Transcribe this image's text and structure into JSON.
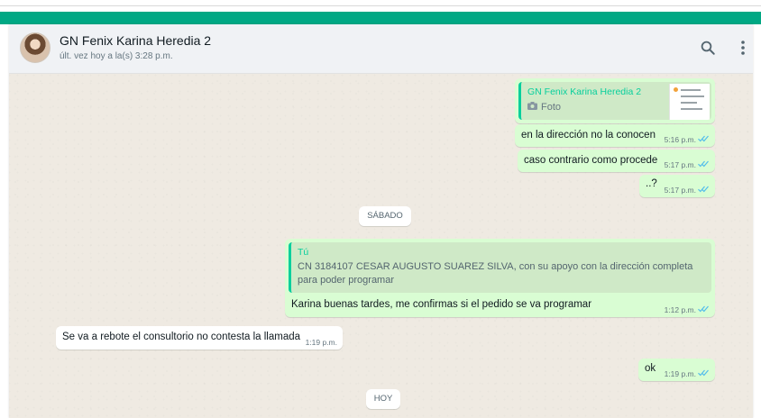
{
  "header": {
    "contact_name": "GN Fenix Karina Heredia 2",
    "status": "últ. vez hoy a la(s) 3:28 p.m.",
    "search_icon": "search-icon",
    "menu_icon": "kebab-menu-icon"
  },
  "colors": {
    "brand": "#00a884",
    "outgoing_bubble": "#d9fdd3",
    "incoming_bubble": "#ffffff",
    "read_ticks": "#53bdeb",
    "chat_background": "#efeae2"
  },
  "messages": [
    {
      "direction": "out",
      "quote_author": "GN Fenix Karina Heredia 2",
      "quote_label": "Foto",
      "quote_icon": "camera-icon"
    },
    {
      "direction": "out",
      "text": "en la dirección no la conocen",
      "time": "5:16 p.m.",
      "status": "read"
    },
    {
      "direction": "out",
      "text": "caso contrario como procede",
      "time": "5:17 p.m.",
      "status": "read"
    },
    {
      "direction": "out",
      "text": "..?",
      "time": "5:17 p.m.",
      "status": "read"
    },
    {
      "type": "day",
      "label": "SÁBADO"
    },
    {
      "direction": "out",
      "quote_author": "Tú",
      "quote_text": "CN 3184107 CESAR AUGUSTO SUAREZ SILVA, con su apoyo con la dirección completa para poder programar",
      "text": "Karina buenas tardes, me confirmas si el pedido se va programar",
      "time": "1:12 p.m.",
      "status": "read"
    },
    {
      "direction": "in",
      "text": "Se va a rebote el consultorio no contesta la llamada",
      "time": "1:19 p.m."
    },
    {
      "direction": "out",
      "text": "ok",
      "time": "1:19 p.m.",
      "status": "read"
    },
    {
      "type": "day",
      "label": "HOY"
    }
  ]
}
